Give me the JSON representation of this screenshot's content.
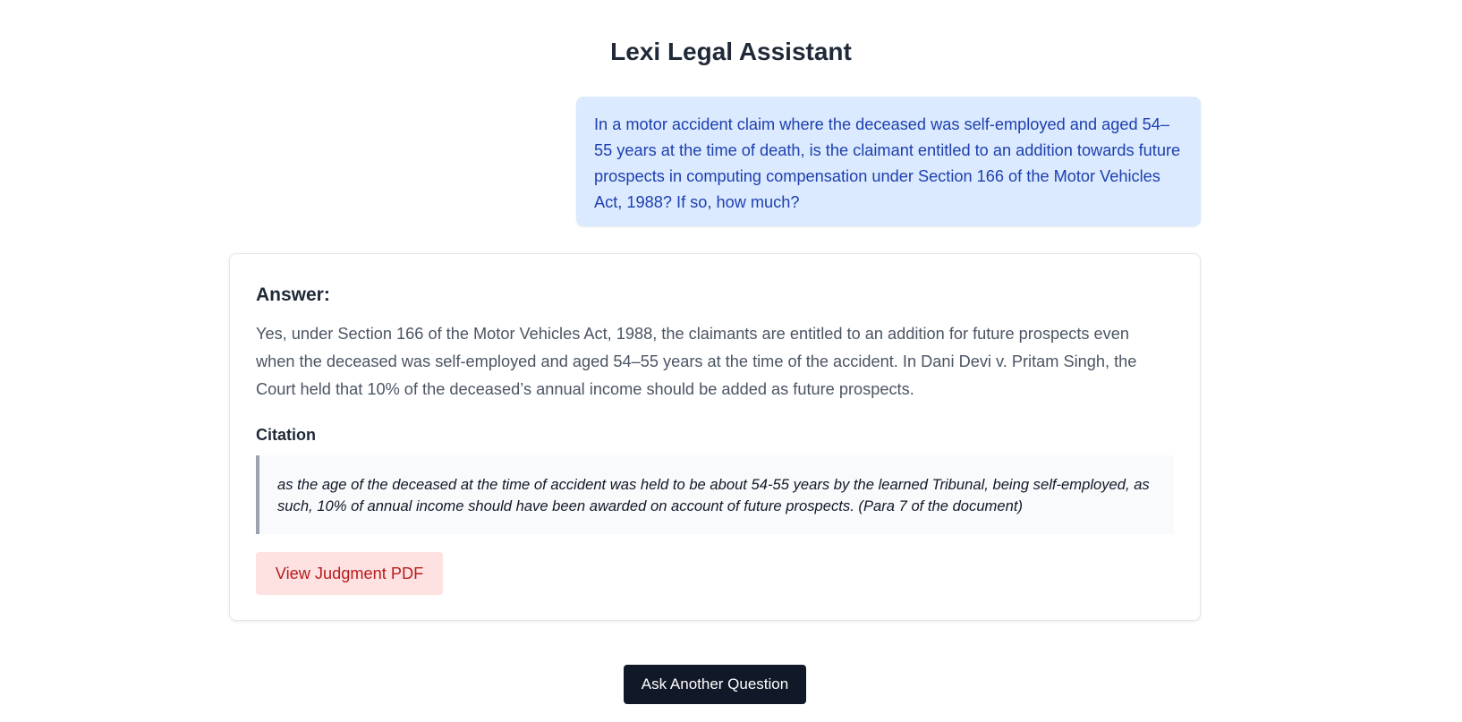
{
  "app": {
    "title": "Lexi Legal Assistant"
  },
  "conversation": {
    "question": "In a motor accident claim where the deceased was self-employed and aged 54–55 years at the time of death, is the claimant entitled to an addition towards future prospects in computing compensation under Section 166 of the Motor Vehicles Act, 1988? If so, how much?",
    "answer_heading": "Answer:",
    "answer_text": "Yes, under Section 166 of the Motor Vehicles Act, 1988, the claimants are entitled to an addition for future prospects even when the deceased was self-employed and aged 54–55 years at the time of the accident. In Dani Devi v. Pritam Singh, the Court held that 10% of the deceased’s annual income should be added as future prospects.",
    "citation_heading": "Citation",
    "citation_text": "as the age of the deceased at the time of accident was held to be about 54-55 years by the learned Tribunal, being self-employed, as such, 10% of annual income should have been awarded on account of future prospects. (Para 7 of the document)",
    "pdf_button_label": "View Judgment PDF"
  },
  "footer": {
    "ask_button_label": "Ask Another Question"
  },
  "colors": {
    "question_bubble_bg": "#dbeafe",
    "question_text": "#1e40af",
    "pdf_button_bg": "#fee2e2",
    "pdf_button_text": "#b91c1c",
    "primary_button_bg": "#111827"
  }
}
